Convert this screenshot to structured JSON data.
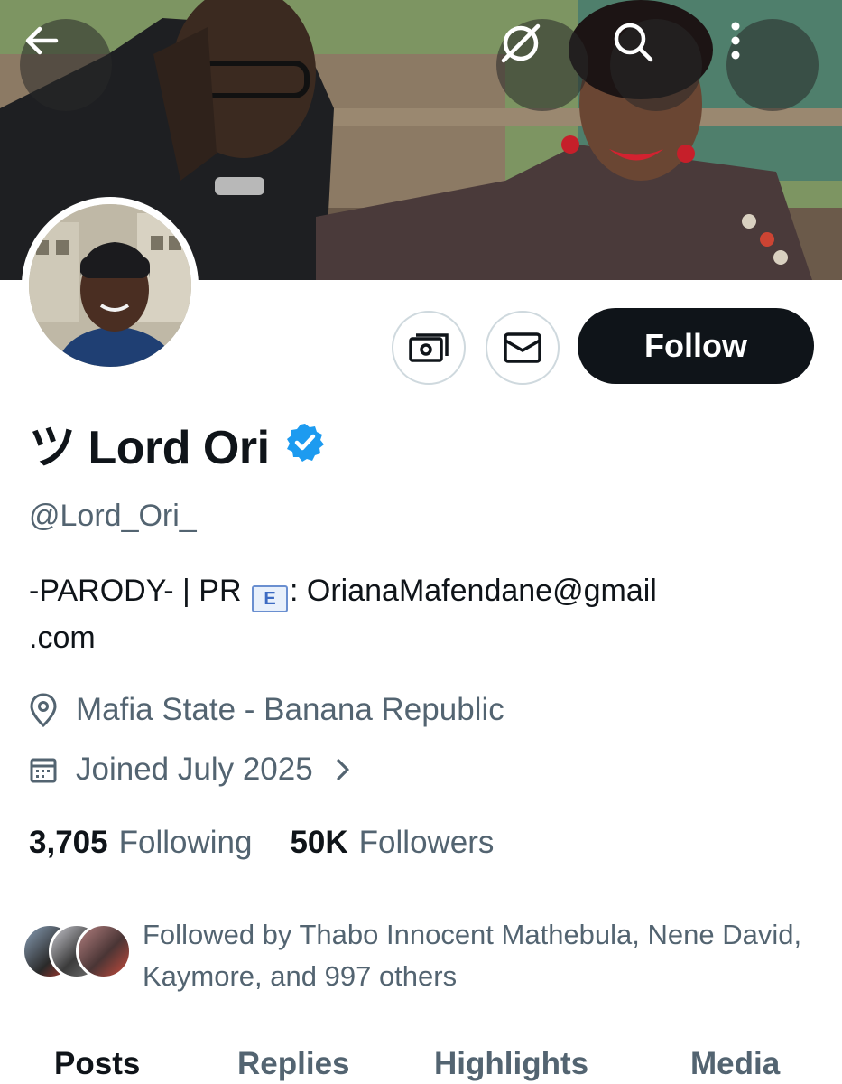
{
  "header": {
    "back_icon": "arrow-left-icon",
    "grok_icon": "slashed-circle-icon",
    "search_icon": "search-icon",
    "more_icon": "more-vertical-icon"
  },
  "actions": {
    "tip_icon": "money-icon",
    "message_icon": "envelope-icon",
    "follow_label": "Follow"
  },
  "profile": {
    "display_name": "ツ Lord Ori",
    "verified": true,
    "verified_color": "#1d9bf0",
    "handle": "@Lord_Ori_",
    "bio_prefix": "-PARODY- | PR ",
    "bio_emoji": "E",
    "bio_suffix_line1": ": OrianaMafendane@gmail",
    "bio_suffix_line2": ".com",
    "location": "Mafia State - Banana Republic",
    "joined": "Joined July 2025"
  },
  "stats": {
    "following_count": "3,705",
    "following_label": "Following",
    "followers_count": "50K",
    "followers_label": "Followers"
  },
  "followed_by": {
    "text": "Followed by Thabo Innocent Mathebula, Nene David, Kaymore, and 997 others"
  },
  "tabs": [
    {
      "label": "Posts",
      "active": true
    },
    {
      "label": "Replies",
      "active": false
    },
    {
      "label": "Highlights",
      "active": false
    },
    {
      "label": "Media",
      "active": false
    }
  ],
  "colors": {
    "text_primary": "#0f1419",
    "text_secondary": "#536471",
    "border": "#cfd9de"
  }
}
